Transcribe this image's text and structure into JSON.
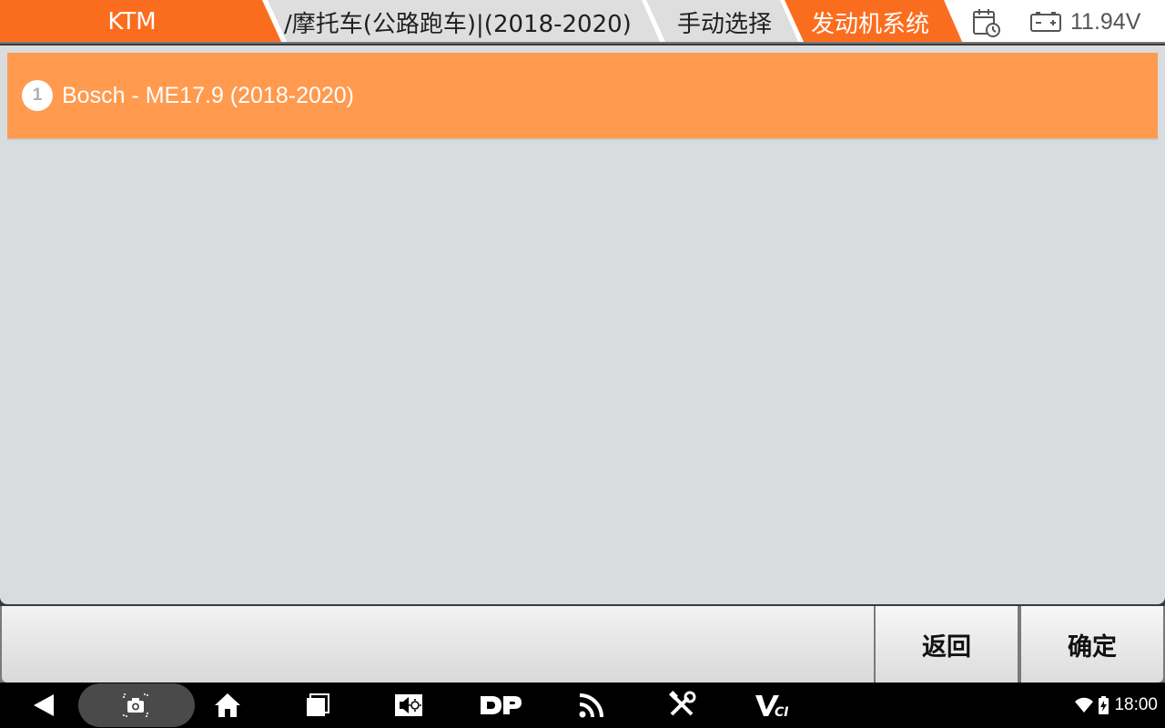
{
  "breadcrumb": {
    "items": [
      {
        "label": "KTM",
        "active": true
      },
      {
        "label": "/摩托车(公路跑车)|(2018-2020)",
        "active": false
      },
      {
        "label": "手动选择",
        "active": false
      },
      {
        "label": "发动机系统",
        "active": true
      }
    ]
  },
  "status_bar": {
    "calendar_icon": "calendar-clock-icon",
    "battery_icon": "car-battery-icon",
    "voltage": "11.94V"
  },
  "list": {
    "items": [
      {
        "number": "1",
        "label": "Bosch - ME17.9 (2018-2020)",
        "selected": true
      }
    ]
  },
  "actions": {
    "back_label": "返回",
    "confirm_label": "确定"
  },
  "navbar": {
    "icons": [
      "back-icon",
      "screenshot-icon",
      "home-icon",
      "recent-apps-icon",
      "display-settings-icon",
      "dp-icon",
      "wireless-icon",
      "tools-icon",
      "vci-icon"
    ],
    "clock": "18:00"
  },
  "colors": {
    "accent": "#fb6d1e",
    "selected_row": "#ff9a4f",
    "content_bg": "#d8dcdf"
  }
}
